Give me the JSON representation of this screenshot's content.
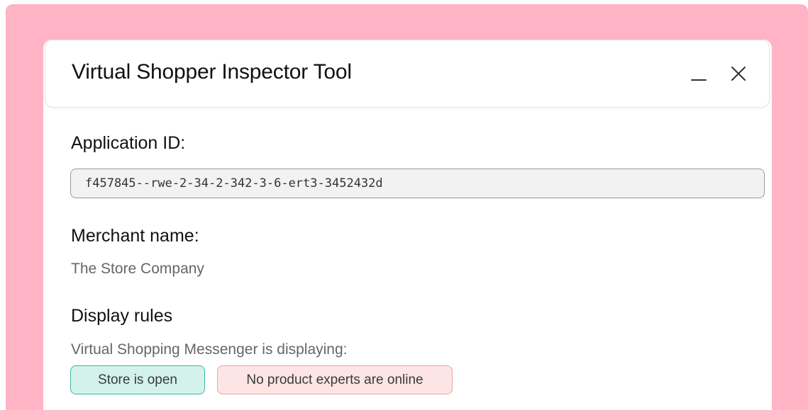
{
  "window": {
    "title": "Virtual Shopper Inspector Tool",
    "minimize_icon": "minimize-icon",
    "close_icon": "close-icon"
  },
  "application": {
    "label": "Application ID:",
    "value": "f457845--rwe-2-34-2-342-3-6-ert3-3452432d"
  },
  "merchant": {
    "label": "Merchant name:",
    "value": "The Store Company"
  },
  "display_rules": {
    "label": "Display rules",
    "description": "Virtual Shopping Messenger is displaying:",
    "badges": [
      {
        "label": "Store is open",
        "status": "success",
        "color": "#3fb59d"
      },
      {
        "label": "No product experts are online",
        "status": "warning",
        "color": "#f2a1a1"
      }
    ]
  },
  "colors": {
    "background": "#ffb3c4",
    "panel": "#ffffff"
  }
}
